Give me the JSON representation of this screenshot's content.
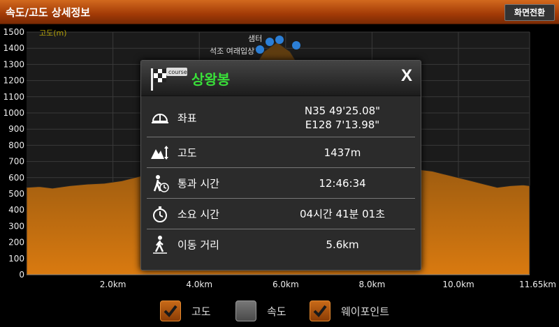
{
  "titlebar": {
    "title": "속도/고도 상세정보",
    "switch_label": "화면전환"
  },
  "chart_data": {
    "type": "area",
    "title": "",
    "ylabel": "고도(m)",
    "xlabel": "",
    "ylim": [
      0,
      1500
    ],
    "xlim": [
      0,
      11.65
    ],
    "y_ticks": [
      "0",
      "100",
      "200",
      "300",
      "400",
      "500",
      "600",
      "700",
      "800",
      "900",
      "1000",
      "1100",
      "1200",
      "1300",
      "1400",
      "1500"
    ],
    "x_ticks": [
      {
        "v": 2.0,
        "label": "2.0km"
      },
      {
        "v": 4.0,
        "label": "4.0km"
      },
      {
        "v": 6.0,
        "label": "6.0km"
      },
      {
        "v": 8.0,
        "label": "8.0km"
      },
      {
        "v": 10.0,
        "label": "10.0km"
      },
      {
        "v": 11.65,
        "label": "11.65km"
      }
    ],
    "series": [
      {
        "x": [
          0,
          0.3,
          0.6,
          1.0,
          1.4,
          1.8,
          2.2,
          2.5,
          2.8,
          3.0,
          3.2,
          3.4,
          3.6,
          3.8,
          4.0,
          4.3,
          4.6,
          4.9,
          5.2,
          5.5,
          5.8,
          6.1,
          6.4,
          6.7,
          7.0,
          7.3,
          7.6,
          7.9,
          8.2,
          8.5,
          8.8,
          9.1,
          9.4,
          9.7,
          10.0,
          10.3,
          10.6,
          10.9,
          11.2,
          11.5,
          11.65
        ],
        "y": [
          540,
          545,
          535,
          550,
          560,
          565,
          580,
          600,
          620,
          650,
          680,
          700,
          720,
          760,
          820,
          900,
          980,
          1100,
          1250,
          1380,
          1437,
          1380,
          1250,
          1100,
          950,
          850,
          780,
          720,
          690,
          680,
          670,
          650,
          640,
          620,
          600,
          580,
          560,
          540,
          550,
          555,
          550
        ]
      }
    ],
    "waypoint_labels": [
      "샘터",
      "석조 여래입상"
    ]
  },
  "popup": {
    "title": "상왕봉",
    "close_label": "X",
    "rows": [
      {
        "label": "좌표",
        "value": [
          "N35 49'25.08\"",
          "E128 7'13.98\""
        ]
      },
      {
        "label": "고도",
        "value": "1437m"
      },
      {
        "label": "통과 시간",
        "value": "12:46:34"
      },
      {
        "label": "소요 시간",
        "value": "04시간 41분 01초"
      },
      {
        "label": "이동 거리",
        "value": "5.6km"
      }
    ]
  },
  "legend": [
    {
      "label": "고도",
      "checked": true
    },
    {
      "label": "속도",
      "checked": false
    },
    {
      "label": "웨이포인트",
      "checked": true
    }
  ],
  "colors": {
    "accent": "#c86a18",
    "area_top": "#6b4512",
    "area_bottom": "#d4740e",
    "title_green": "#39e039"
  }
}
